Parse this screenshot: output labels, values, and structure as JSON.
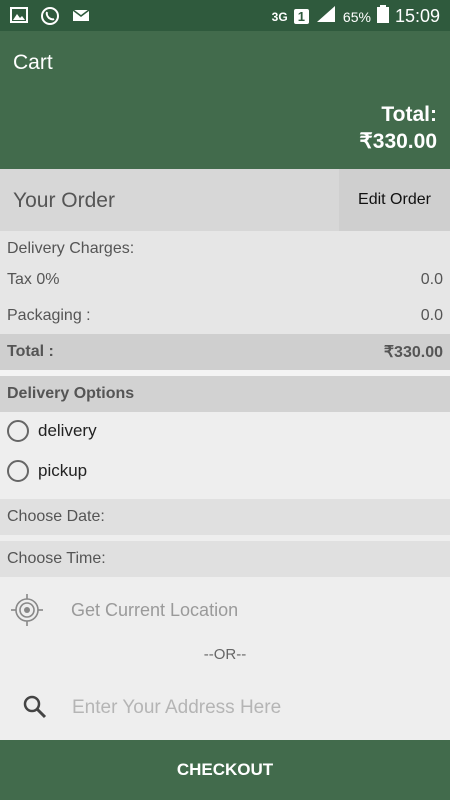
{
  "status_bar": {
    "network": "3G",
    "sim": "1",
    "battery_percent": "65%",
    "time": "15:09",
    "left_icons": [
      "gallery-icon",
      "whatsapp-icon",
      "mail-icon"
    ]
  },
  "header": {
    "title": "Cart",
    "total_label": "Total:",
    "total_value": "₹330.00"
  },
  "order": {
    "title": "Your Order",
    "edit_label": "Edit Order",
    "rows": [
      {
        "label": "Delivery Charges:",
        "value": ""
      },
      {
        "label": "Tax 0%",
        "value": "0.0"
      },
      {
        "label": "Packaging :",
        "value": "0.0"
      },
      {
        "label": "Total :",
        "value": "₹330.00"
      }
    ]
  },
  "delivery_options": {
    "title": "Delivery Options",
    "options": [
      {
        "label": "delivery",
        "selected": false
      },
      {
        "label": "pickup",
        "selected": false
      }
    ]
  },
  "schedule": {
    "date_label": "Choose Date:",
    "time_label": "Choose Time:"
  },
  "location": {
    "current_label": "Get Current Location",
    "or_label": "--OR--",
    "address_placeholder": "Enter Your Address Here"
  },
  "checkout_label": "CHECKOUT",
  "colors": {
    "status_bar": "#2f5a3d",
    "primary": "#426b4c",
    "section_gray": "#d7d7d7"
  }
}
